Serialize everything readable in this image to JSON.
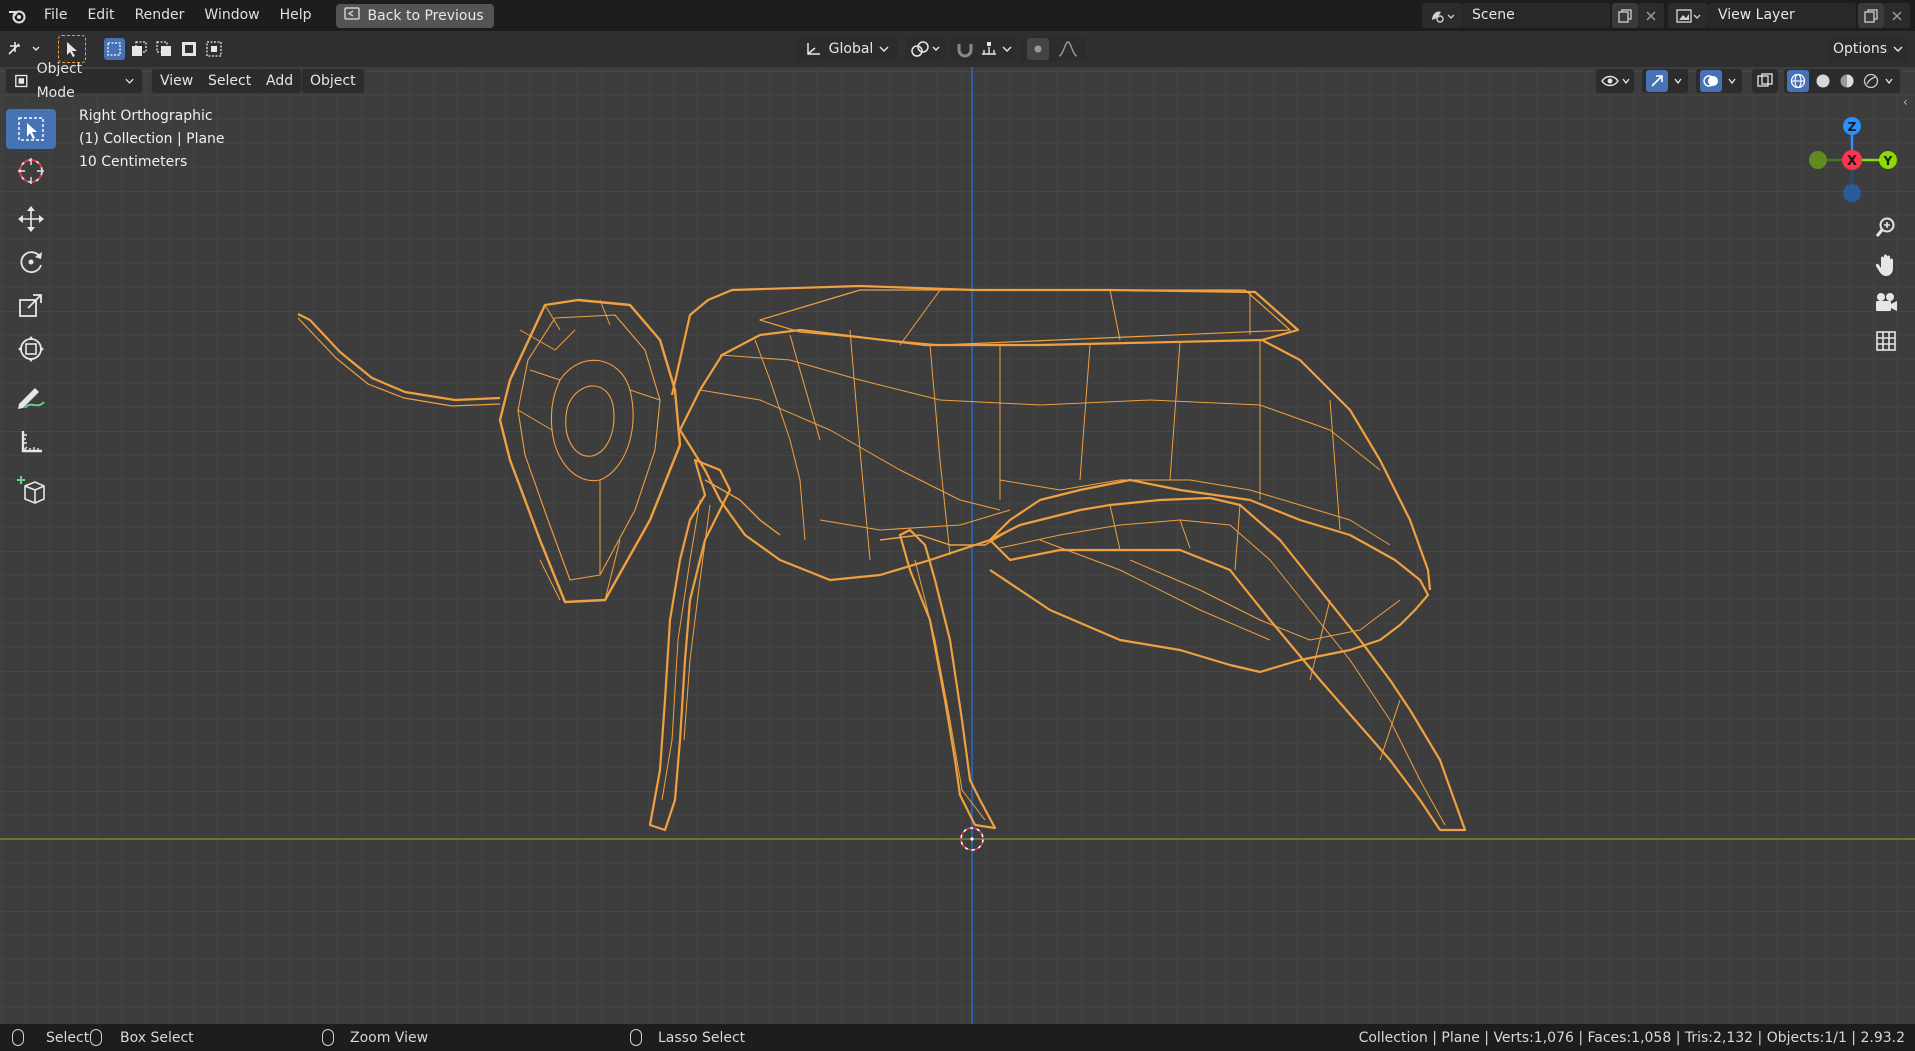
{
  "menu": [
    "File",
    "Edit",
    "Render",
    "Window",
    "Help"
  ],
  "back_button": "Back to Previous",
  "scene": {
    "name": "Scene",
    "view_layer": "View Layer"
  },
  "tool_header": {
    "orientation": "Global",
    "options": "Options"
  },
  "viewport_header": {
    "mode": "Object Mode",
    "menus": [
      "View",
      "Select",
      "Add",
      "Object"
    ]
  },
  "overlay": {
    "view_name": "Right Orthographic",
    "collection": "(1) Collection | Plane",
    "scale": "10 Centimeters"
  },
  "gizmo": {
    "z": "Z",
    "x": "X",
    "y": "Y"
  },
  "status": {
    "select": "Select",
    "box_select": "Box Select",
    "zoom_view": "Zoom View",
    "lasso_select": "Lasso Select",
    "stats": "Collection | Plane | Verts:1,076 | Faces:1,058 | Tris:2,132 | Objects:1/1 | 2.93.2"
  },
  "colors": {
    "selection": "#f0a040",
    "active_tool": "#4772b3",
    "x_axis": "#ff3352",
    "y_axis": "#8bdc00",
    "z_axis": "#2890ff",
    "grid": "#474747"
  },
  "icons": [
    "blender-logo-icon",
    "back-icon",
    "scene-icon",
    "new-scene-icon",
    "close-icon",
    "view-layer-icon",
    "editor-type-icon",
    "cursor-icon",
    "select-box-icon",
    "move-icon",
    "rotate-icon",
    "scale-icon",
    "transform-icon",
    "annotate-icon",
    "measure-icon",
    "add-cube-icon",
    "zoom-icon",
    "hand-icon",
    "camera-icon",
    "grid-icon"
  ]
}
